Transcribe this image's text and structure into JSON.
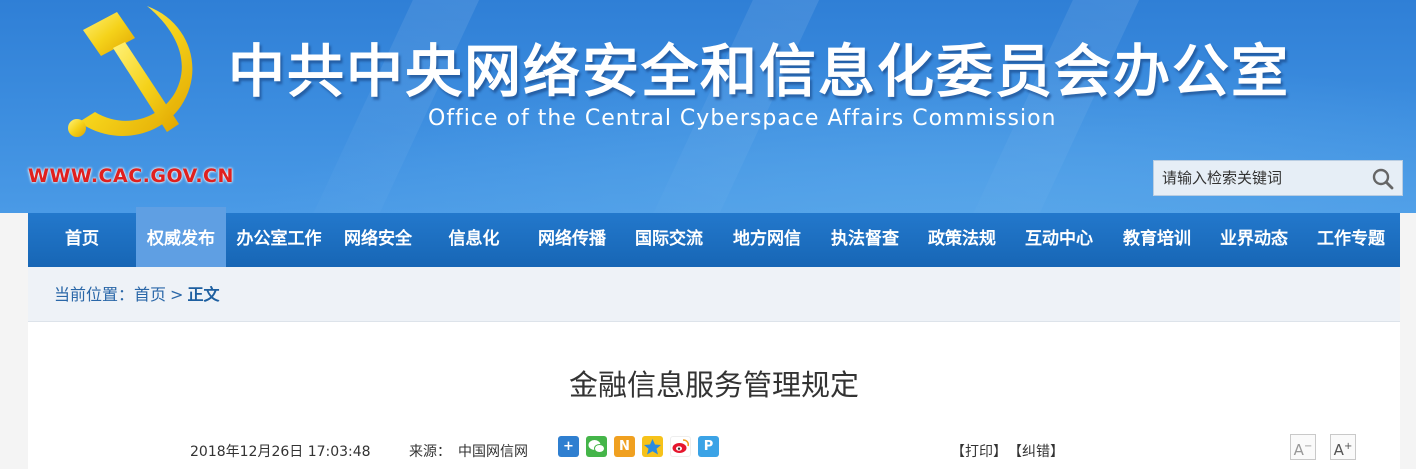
{
  "header": {
    "title_cn": "中共中央网络安全和信息化委员会办公室",
    "title_en": "Office of the Central Cyberspace Affairs Commission",
    "site_url": "WWW.CAC.GOV.CN",
    "emblem_icon": "party-emblem-icon"
  },
  "search": {
    "placeholder": "请输入检索关键词",
    "icon": "search-icon"
  },
  "nav": {
    "items": [
      {
        "label": "首页"
      },
      {
        "label": "权威发布"
      },
      {
        "label": "办公室工作"
      },
      {
        "label": "网络安全"
      },
      {
        "label": "信息化"
      },
      {
        "label": "网络传播"
      },
      {
        "label": "国际交流"
      },
      {
        "label": "地方网信"
      },
      {
        "label": "执法督查"
      },
      {
        "label": "政策法规"
      },
      {
        "label": "互动中心"
      },
      {
        "label": "教育培训"
      },
      {
        "label": "业界动态"
      },
      {
        "label": "工作专题"
      }
    ],
    "active_index": 1
  },
  "breadcrumb": {
    "prefix": "当前位置：",
    "home": "首页",
    "separator": ">",
    "current": "正文"
  },
  "article": {
    "title": "金融信息服务管理规定",
    "date": "2018年12月26日 17:03:48",
    "source_label": "来源：",
    "source": "中国网信网",
    "share_icons": [
      "share-plus-icon",
      "wechat-icon",
      "n-icon",
      "qzone-icon",
      "weibo-icon",
      "p-icon"
    ],
    "print_label": "【打印】",
    "correction_label": "【纠错】",
    "font_decrease": "A",
    "font_increase": "A"
  },
  "colors": {
    "banner_blue": "#3e8fe0",
    "nav_blue": "#1766b5",
    "nav_active": "#5f9fe3",
    "url_red": "#e0201e",
    "emblem_gold": "#f5d21a"
  }
}
